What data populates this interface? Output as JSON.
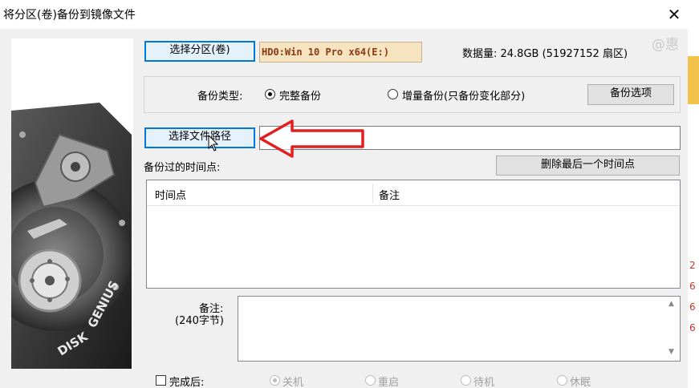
{
  "window": {
    "title": "将分区(卷)备份到镜像文件",
    "close_glyph": "✕"
  },
  "watermark": "@惠",
  "source": {
    "select_partition_button": "选择分区(卷)",
    "partition_info": "HD0:Win 10 Pro x64(E:)",
    "data_size": "数据量: 24.8GB (51927152 扇区)"
  },
  "backup_type": {
    "label": "备份类型:",
    "options": [
      "完整备份",
      "增量备份(只备份变化部分)"
    ],
    "selected": "完整备份",
    "options_button": "备份选项"
  },
  "destination": {
    "select_path_button": "选择文件路径",
    "path_value": ""
  },
  "history": {
    "label": "备份过的时间点:",
    "delete_last_button": "删除最后一个时间点",
    "columns": [
      "时间点",
      "备注"
    ],
    "rows": []
  },
  "remark": {
    "label_line1": "备注:",
    "label_line2": "(240字节)",
    "value": ""
  },
  "after_completion": {
    "label": "完成后:",
    "checked": false,
    "options": [
      "关机",
      "重启",
      "待机",
      "休眠"
    ],
    "selected": "关机",
    "enabled": false
  },
  "side_image": {
    "brand_text": "DISK GENIUS",
    "icon": "hard-disk-image"
  },
  "annotation": {
    "icon": "red-arrow-left-icon",
    "color": "#e02020"
  },
  "colors": {
    "accent": "#0078d7",
    "partition_text": "#8a3a12",
    "partition_bg": "#f6e3c0"
  },
  "right_strip_fragments": [
    "2",
    "6",
    "6",
    "6"
  ]
}
